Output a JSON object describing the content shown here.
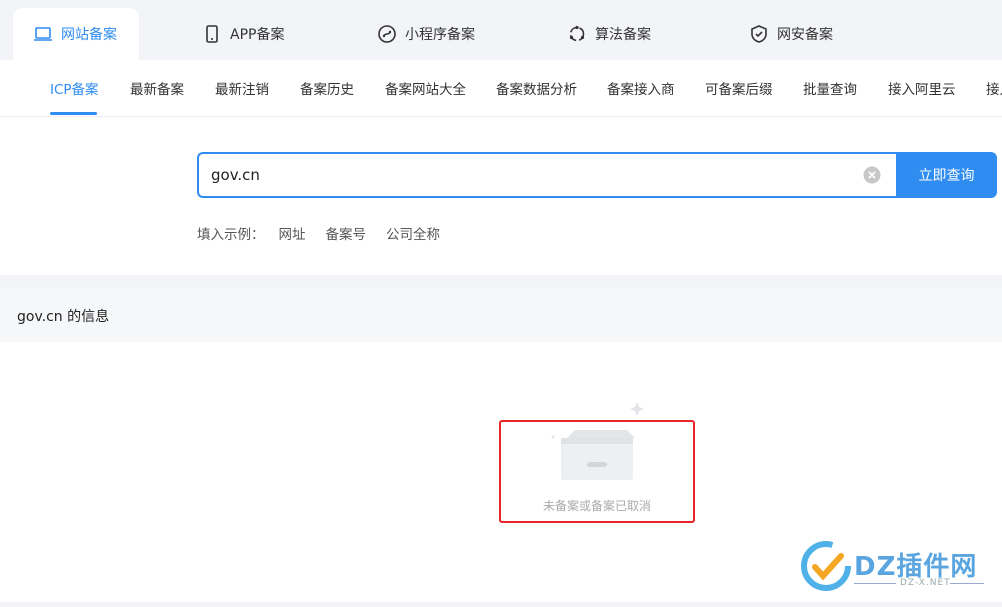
{
  "top_tabs": [
    {
      "label": "网站备案",
      "icon": "laptop-icon",
      "active": true
    },
    {
      "label": "APP备案",
      "icon": "phone-icon"
    },
    {
      "label": "小程序备案",
      "icon": "miniprogram-icon"
    },
    {
      "label": "算法备案",
      "icon": "algorithm-icon"
    },
    {
      "label": "网安备案",
      "icon": "shield-icon"
    }
  ],
  "subnav": [
    {
      "label": "ICP备案",
      "active": true
    },
    {
      "label": "最新备案"
    },
    {
      "label": "最新注销"
    },
    {
      "label": "备案历史"
    },
    {
      "label": "备案网站大全"
    },
    {
      "label": "备案数据分析"
    },
    {
      "label": "备案接入商"
    },
    {
      "label": "可备案后缀"
    },
    {
      "label": "批量查询"
    },
    {
      "label": "接入阿里云"
    },
    {
      "label": "接入"
    }
  ],
  "search": {
    "value": "gov.cn",
    "button_label": "立即查询",
    "examples_label": "填入示例：",
    "examples": [
      "网址",
      "备案号",
      "公司全称"
    ]
  },
  "info": {
    "title": "gov.cn 的信息",
    "empty_text": "未备案或备案已取消"
  },
  "watermark": {
    "brand": "DZ插件网",
    "sub": "DZ-X.NET"
  },
  "colors": {
    "accent": "#2f8cf0",
    "highlight_border": "#e8262a"
  }
}
